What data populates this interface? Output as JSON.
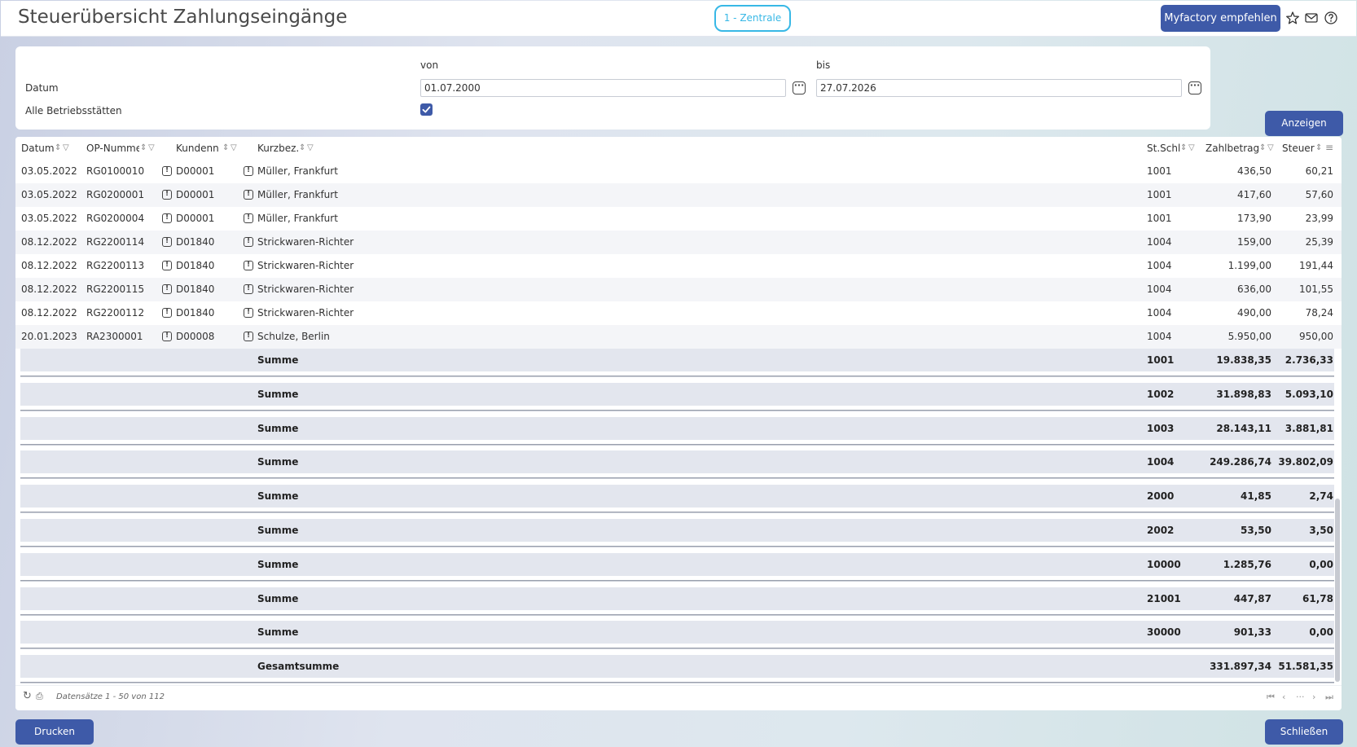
{
  "header": {
    "title": "Steuerübersicht Zahlungseingänge",
    "branch": "1 - Zentrale",
    "recommend_label": "Myfactory empfehlen"
  },
  "filter": {
    "from_label": "von",
    "to_label": "bis",
    "date_label": "Datum",
    "date_from": "01.07.2000",
    "date_to": "27.07.2026",
    "all_sites_label": "Alle Betriebsstätten",
    "all_sites_checked": true,
    "show_button": "Anzeigen"
  },
  "grid": {
    "columns": [
      "Datum",
      "OP-Numme",
      "Kundenn",
      "Kurzbez.",
      "St.Schl",
      "Zahlbetrag",
      "Steuer"
    ],
    "rows": [
      {
        "datum": "03.05.2022",
        "op": "RG0100010",
        "kunde": "D00001",
        "kurz": "Müller, Frankfurt",
        "stschl": "1001",
        "zahlbetrag": "436,50",
        "steuer": "60,21"
      },
      {
        "datum": "03.05.2022",
        "op": "RG0200001",
        "kunde": "D00001",
        "kurz": "Müller, Frankfurt",
        "stschl": "1001",
        "zahlbetrag": "417,60",
        "steuer": "57,60"
      },
      {
        "datum": "03.05.2022",
        "op": "RG0200004",
        "kunde": "D00001",
        "kurz": "Müller, Frankfurt",
        "stschl": "1001",
        "zahlbetrag": "173,90",
        "steuer": "23,99"
      },
      {
        "datum": "08.12.2022",
        "op": "RG2200114",
        "kunde": "D01840",
        "kurz": "Strickwaren-Richter",
        "stschl": "1004",
        "zahlbetrag": "159,00",
        "steuer": "25,39"
      },
      {
        "datum": "08.12.2022",
        "op": "RG2200113",
        "kunde": "D01840",
        "kurz": "Strickwaren-Richter",
        "stschl": "1004",
        "zahlbetrag": "1.199,00",
        "steuer": "191,44"
      },
      {
        "datum": "08.12.2022",
        "op": "RG2200115",
        "kunde": "D01840",
        "kurz": "Strickwaren-Richter",
        "stschl": "1004",
        "zahlbetrag": "636,00",
        "steuer": "101,55"
      },
      {
        "datum": "08.12.2022",
        "op": "RG2200112",
        "kunde": "D01840",
        "kurz": "Strickwaren-Richter",
        "stschl": "1004",
        "zahlbetrag": "490,00",
        "steuer": "78,24"
      },
      {
        "datum": "20.01.2023",
        "op": "RA2300001",
        "kunde": "D00008",
        "kurz": "Schulze, Berlin",
        "stschl": "1004",
        "zahlbetrag": "5.950,00",
        "steuer": "950,00"
      }
    ],
    "sums": [
      {
        "label": "Summe",
        "stschl": "1001",
        "zahlbetrag": "19.838,35",
        "steuer": "2.736,33"
      },
      {
        "label": "Summe",
        "stschl": "1002",
        "zahlbetrag": "31.898,83",
        "steuer": "5.093,10"
      },
      {
        "label": "Summe",
        "stschl": "1003",
        "zahlbetrag": "28.143,11",
        "steuer": "3.881,81"
      },
      {
        "label": "Summe",
        "stschl": "1004",
        "zahlbetrag": "249.286,74",
        "steuer": "39.802,09"
      },
      {
        "label": "Summe",
        "stschl": "2000",
        "zahlbetrag": "41,85",
        "steuer": "2,74"
      },
      {
        "label": "Summe",
        "stschl": "2002",
        "zahlbetrag": "53,50",
        "steuer": "3,50"
      },
      {
        "label": "Summe",
        "stschl": "10000",
        "zahlbetrag": "1.285,76",
        "steuer": "0,00"
      },
      {
        "label": "Summe",
        "stschl": "21001",
        "zahlbetrag": "447,87",
        "steuer": "61,78"
      },
      {
        "label": "Summe",
        "stschl": "30000",
        "zahlbetrag": "901,33",
        "steuer": "0,00"
      },
      {
        "label": "Gesamtsumme",
        "stschl": "",
        "zahlbetrag": "331.897,34",
        "steuer": "51.581,35"
      }
    ],
    "footer_info": "Datensätze 1 - 50 von 112"
  },
  "actions": {
    "print": "Drucken",
    "close": "Schließen"
  },
  "colors": {
    "primary": "#3e5aa8",
    "badge": "#38b8e6"
  }
}
